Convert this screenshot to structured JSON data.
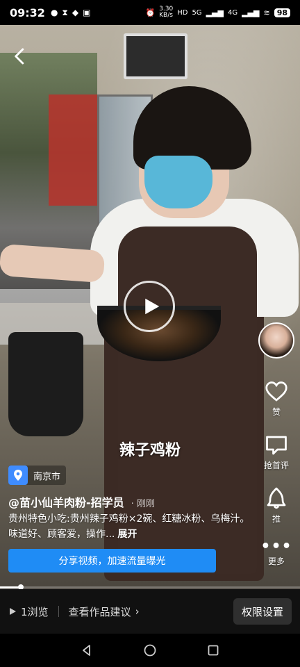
{
  "status_bar": {
    "time": "09:32",
    "network_speed": "3.30\nKB/s",
    "signal_5g": "5G",
    "signal_4g": "4G",
    "hd_label": "HD",
    "battery": "98"
  },
  "video": {
    "caption_overlay": "辣子鸡粉",
    "playback_progress": 0.07
  },
  "right_rail": {
    "like_label": "赞",
    "comment_label": "抢首评",
    "recommend_label": "推",
    "more_label": "更多"
  },
  "post": {
    "location": "南京市",
    "author": "@苗小仙羊肉粉-招学员",
    "time_ago": "· 刚刚",
    "description": "贵州特色小吃:贵州辣子鸡粉×2碗、红糖冰粉、乌梅汁。 味道好、顾客爱，操作...",
    "expand_label": "展开",
    "share_button": "分享视频，加速流量曝光"
  },
  "bottom_bar": {
    "views": "1浏览",
    "suggestion": "查看作品建议",
    "permission_button": "权限设置"
  },
  "colors": {
    "accent": "#1f8cf5",
    "location_badge": "#3f8cff"
  }
}
